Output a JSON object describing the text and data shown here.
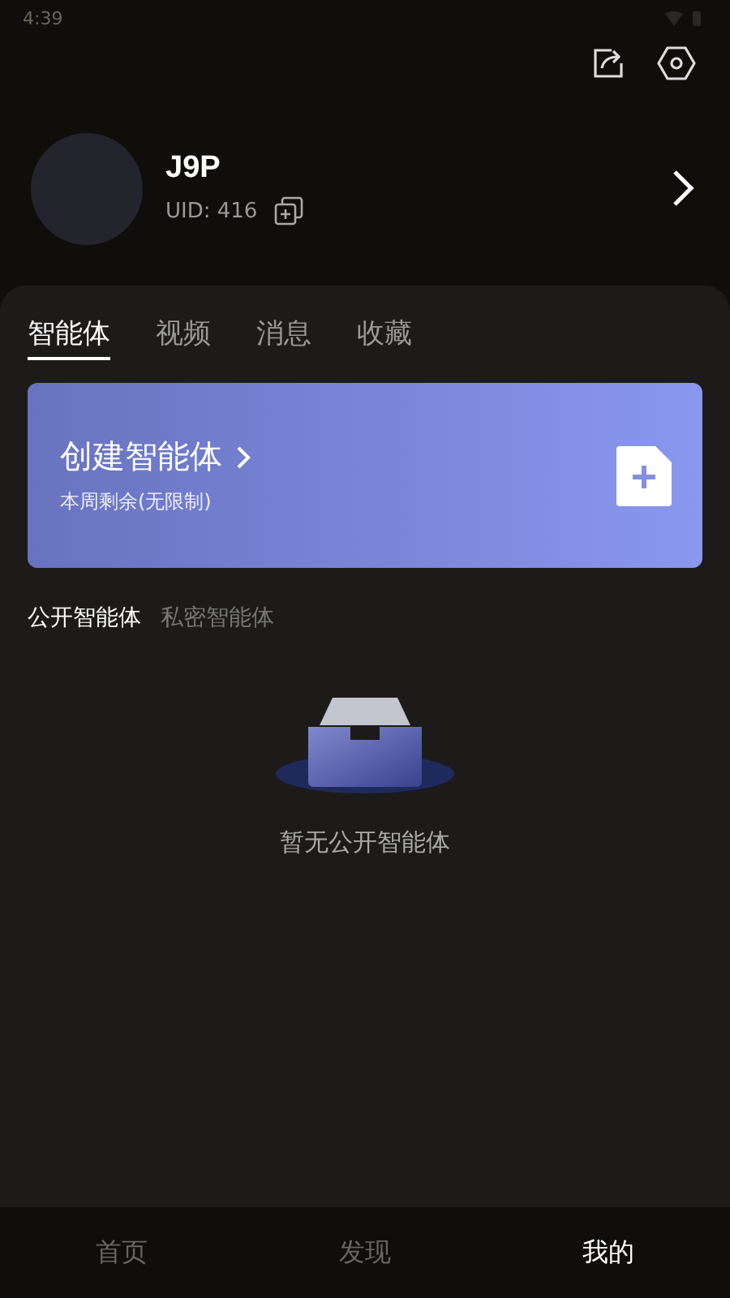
{
  "status_bar": {
    "time": "4:39"
  },
  "profile": {
    "name": "J9P",
    "uid": "UID: 416"
  },
  "tabs": [
    {
      "label": "智能体",
      "selected": true
    },
    {
      "label": "视频",
      "selected": false
    },
    {
      "label": "消息",
      "selected": false
    },
    {
      "label": "收藏",
      "selected": false
    }
  ],
  "create_card": {
    "title": "创建智能体",
    "subtitle": "本周剩余(无限制)"
  },
  "sub_tabs": [
    {
      "label": "公开智能体",
      "selected": true
    },
    {
      "label": "私密智能体",
      "selected": false
    }
  ],
  "empty_state": {
    "message": "暂无公开智能体"
  },
  "bottom_nav": [
    {
      "label": "首页",
      "selected": false
    },
    {
      "label": "发现",
      "selected": false
    },
    {
      "label": "我的",
      "selected": true
    }
  ]
}
